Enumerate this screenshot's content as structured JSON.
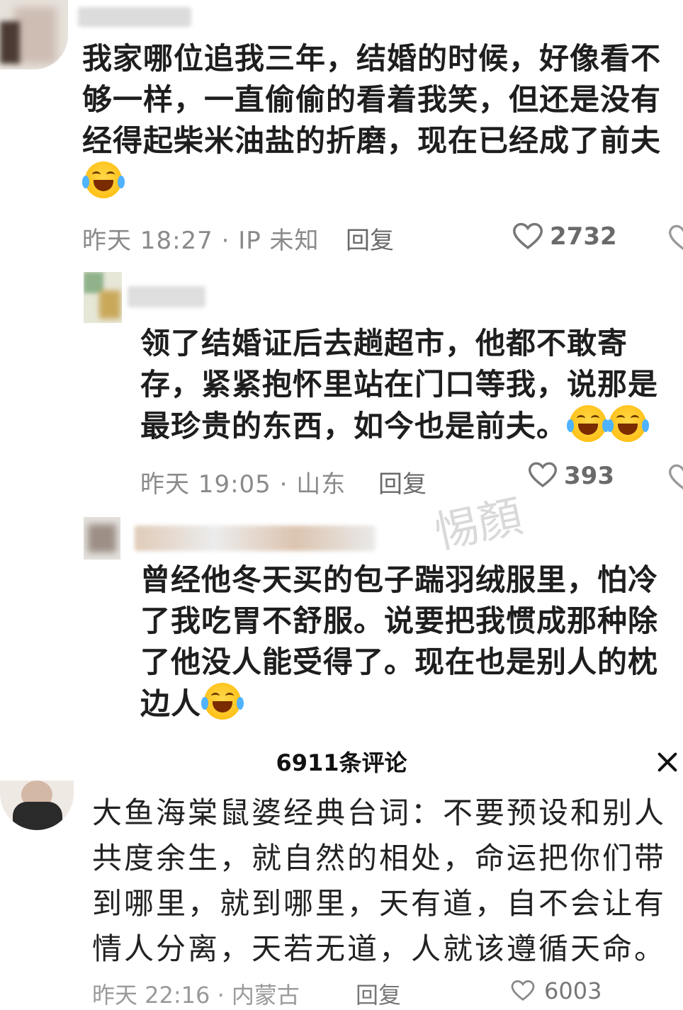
{
  "comments": [
    {
      "text": "我家哪位追我三年，结婚的时候，好像看不够一样，一直偷偷的看着我笑，但还是没有经得起柴米油盐的折磨，现在已经成了前夫",
      "emoji_count": 1,
      "time": "昨天 18:27 · IP 未知",
      "reply_label": "回复",
      "likes": "2732"
    },
    {
      "text": "领了结婚证后去趟超市，他都不敢寄存，紧紧抱怀里站在门口等我，说那是最珍贵的东西，如今也是前夫。",
      "emoji_count": 2,
      "time": "昨天 19:05 · 山东",
      "reply_label": "回复",
      "likes": "393"
    },
    {
      "text": "曾经他冬天买的包子踹羽绒服里，怕冷了我吃胃不舒服。说要把我惯成那种除了他没人能受得了。现在也是别人的枕边人",
      "emoji_count": 1
    }
  ],
  "watermark": "惕顏",
  "panel": {
    "title": "6911条评论",
    "top_comment": {
      "text": "大鱼海棠鼠婆经典台词：不要预设和别人共度余生，就自然的相处，命运把你们带到哪里，就到哪里，天有道，自不会让有情人分离，天若无道，人就该遵循天命。",
      "time": "昨天 22:16 · 内蒙古",
      "reply_label": "回复",
      "likes": "6003"
    }
  },
  "icons": {
    "like": "heart-outline-icon",
    "close": "close-icon",
    "emoji": "laughing-crying-emoji"
  },
  "colors": {
    "text": "#1e1e1e",
    "meta": "#8a8a8a",
    "heart": "#777777"
  }
}
